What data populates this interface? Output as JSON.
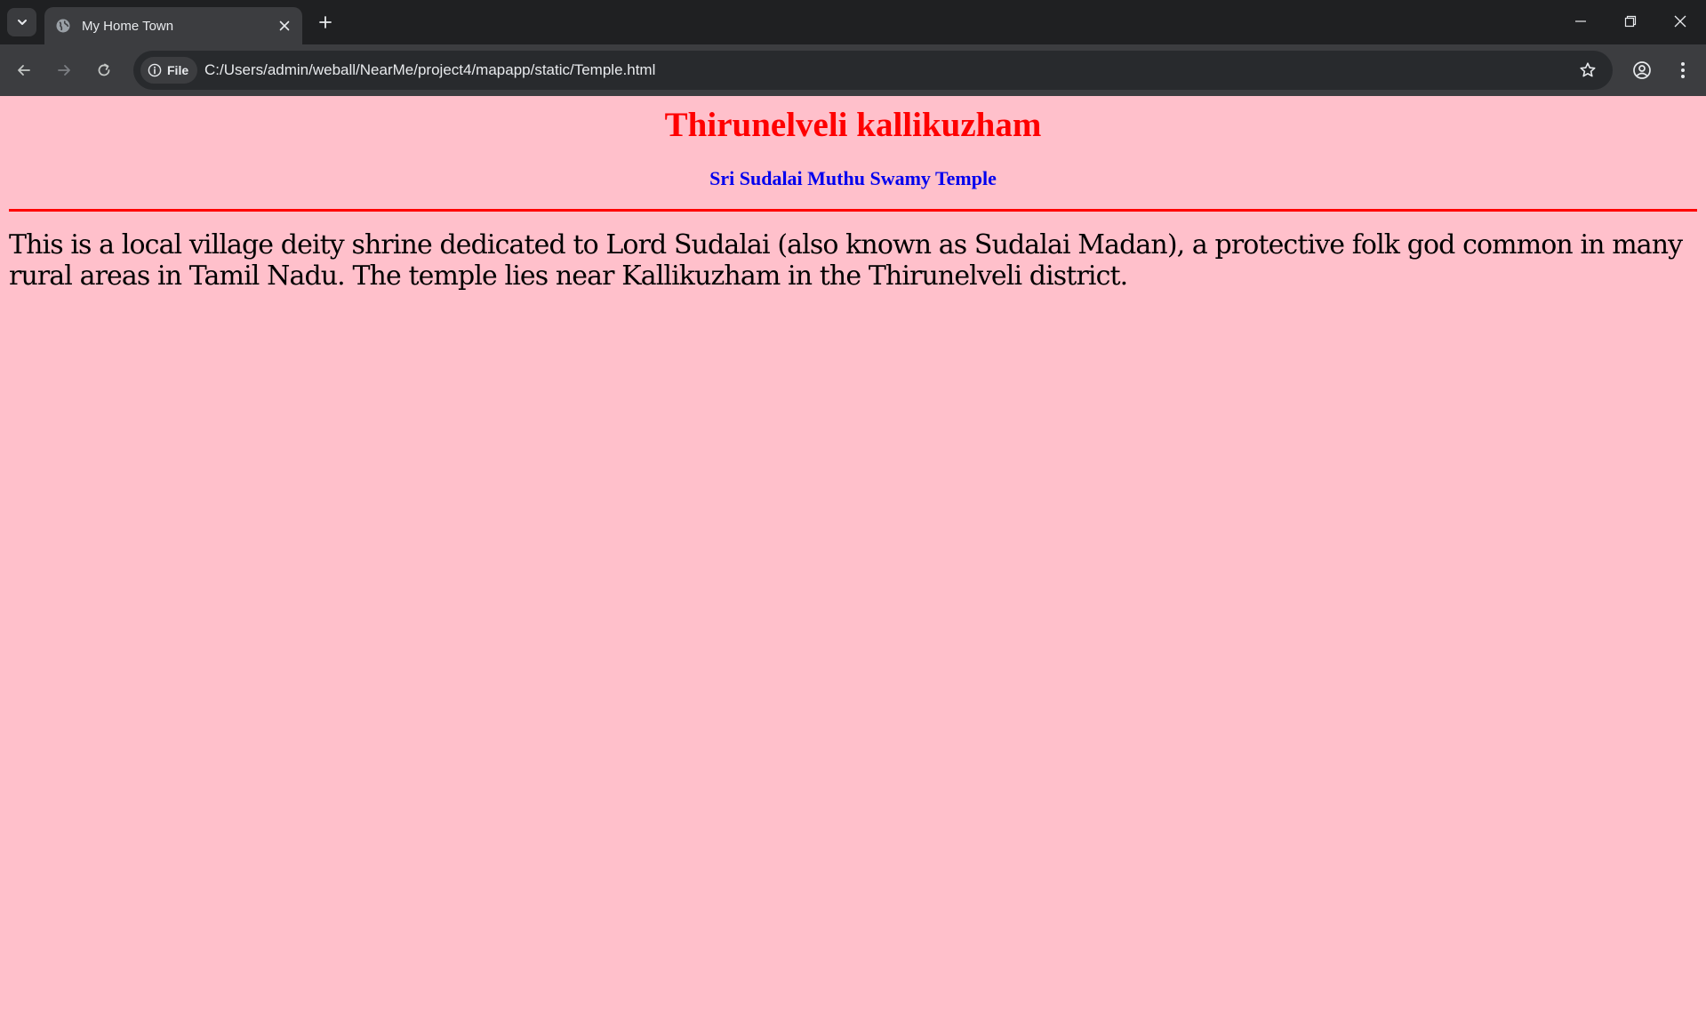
{
  "browser": {
    "tab": {
      "title": "My Home Town",
      "favicon": "globe-icon"
    },
    "omnibox": {
      "chip_label": "File",
      "url": "C:/Users/admin/weball/NearMe/project4/mapapp/static/Temple.html"
    },
    "colors": {
      "frame": "#1f2022",
      "toolbar": "#3c3d40",
      "omnibox": "#282a2d",
      "icon": "#c4c7c5"
    }
  },
  "page": {
    "title": "Thirunelveli kallikuzham",
    "subtitle": "Sri Sudalai Muthu Swamy Temple",
    "body": "This is a local village deity shrine dedicated to Lord Sudalai (also known as Sudalai Madan), a protective folk god common in many rural areas in Tamil Nadu. The temple lies near Kallikuzham in the Thirunelveli district.",
    "colors": {
      "background": "#ffc0cb",
      "title": "#ff0000",
      "subtitle": "#0000ee",
      "divider": "#ff0000"
    }
  }
}
